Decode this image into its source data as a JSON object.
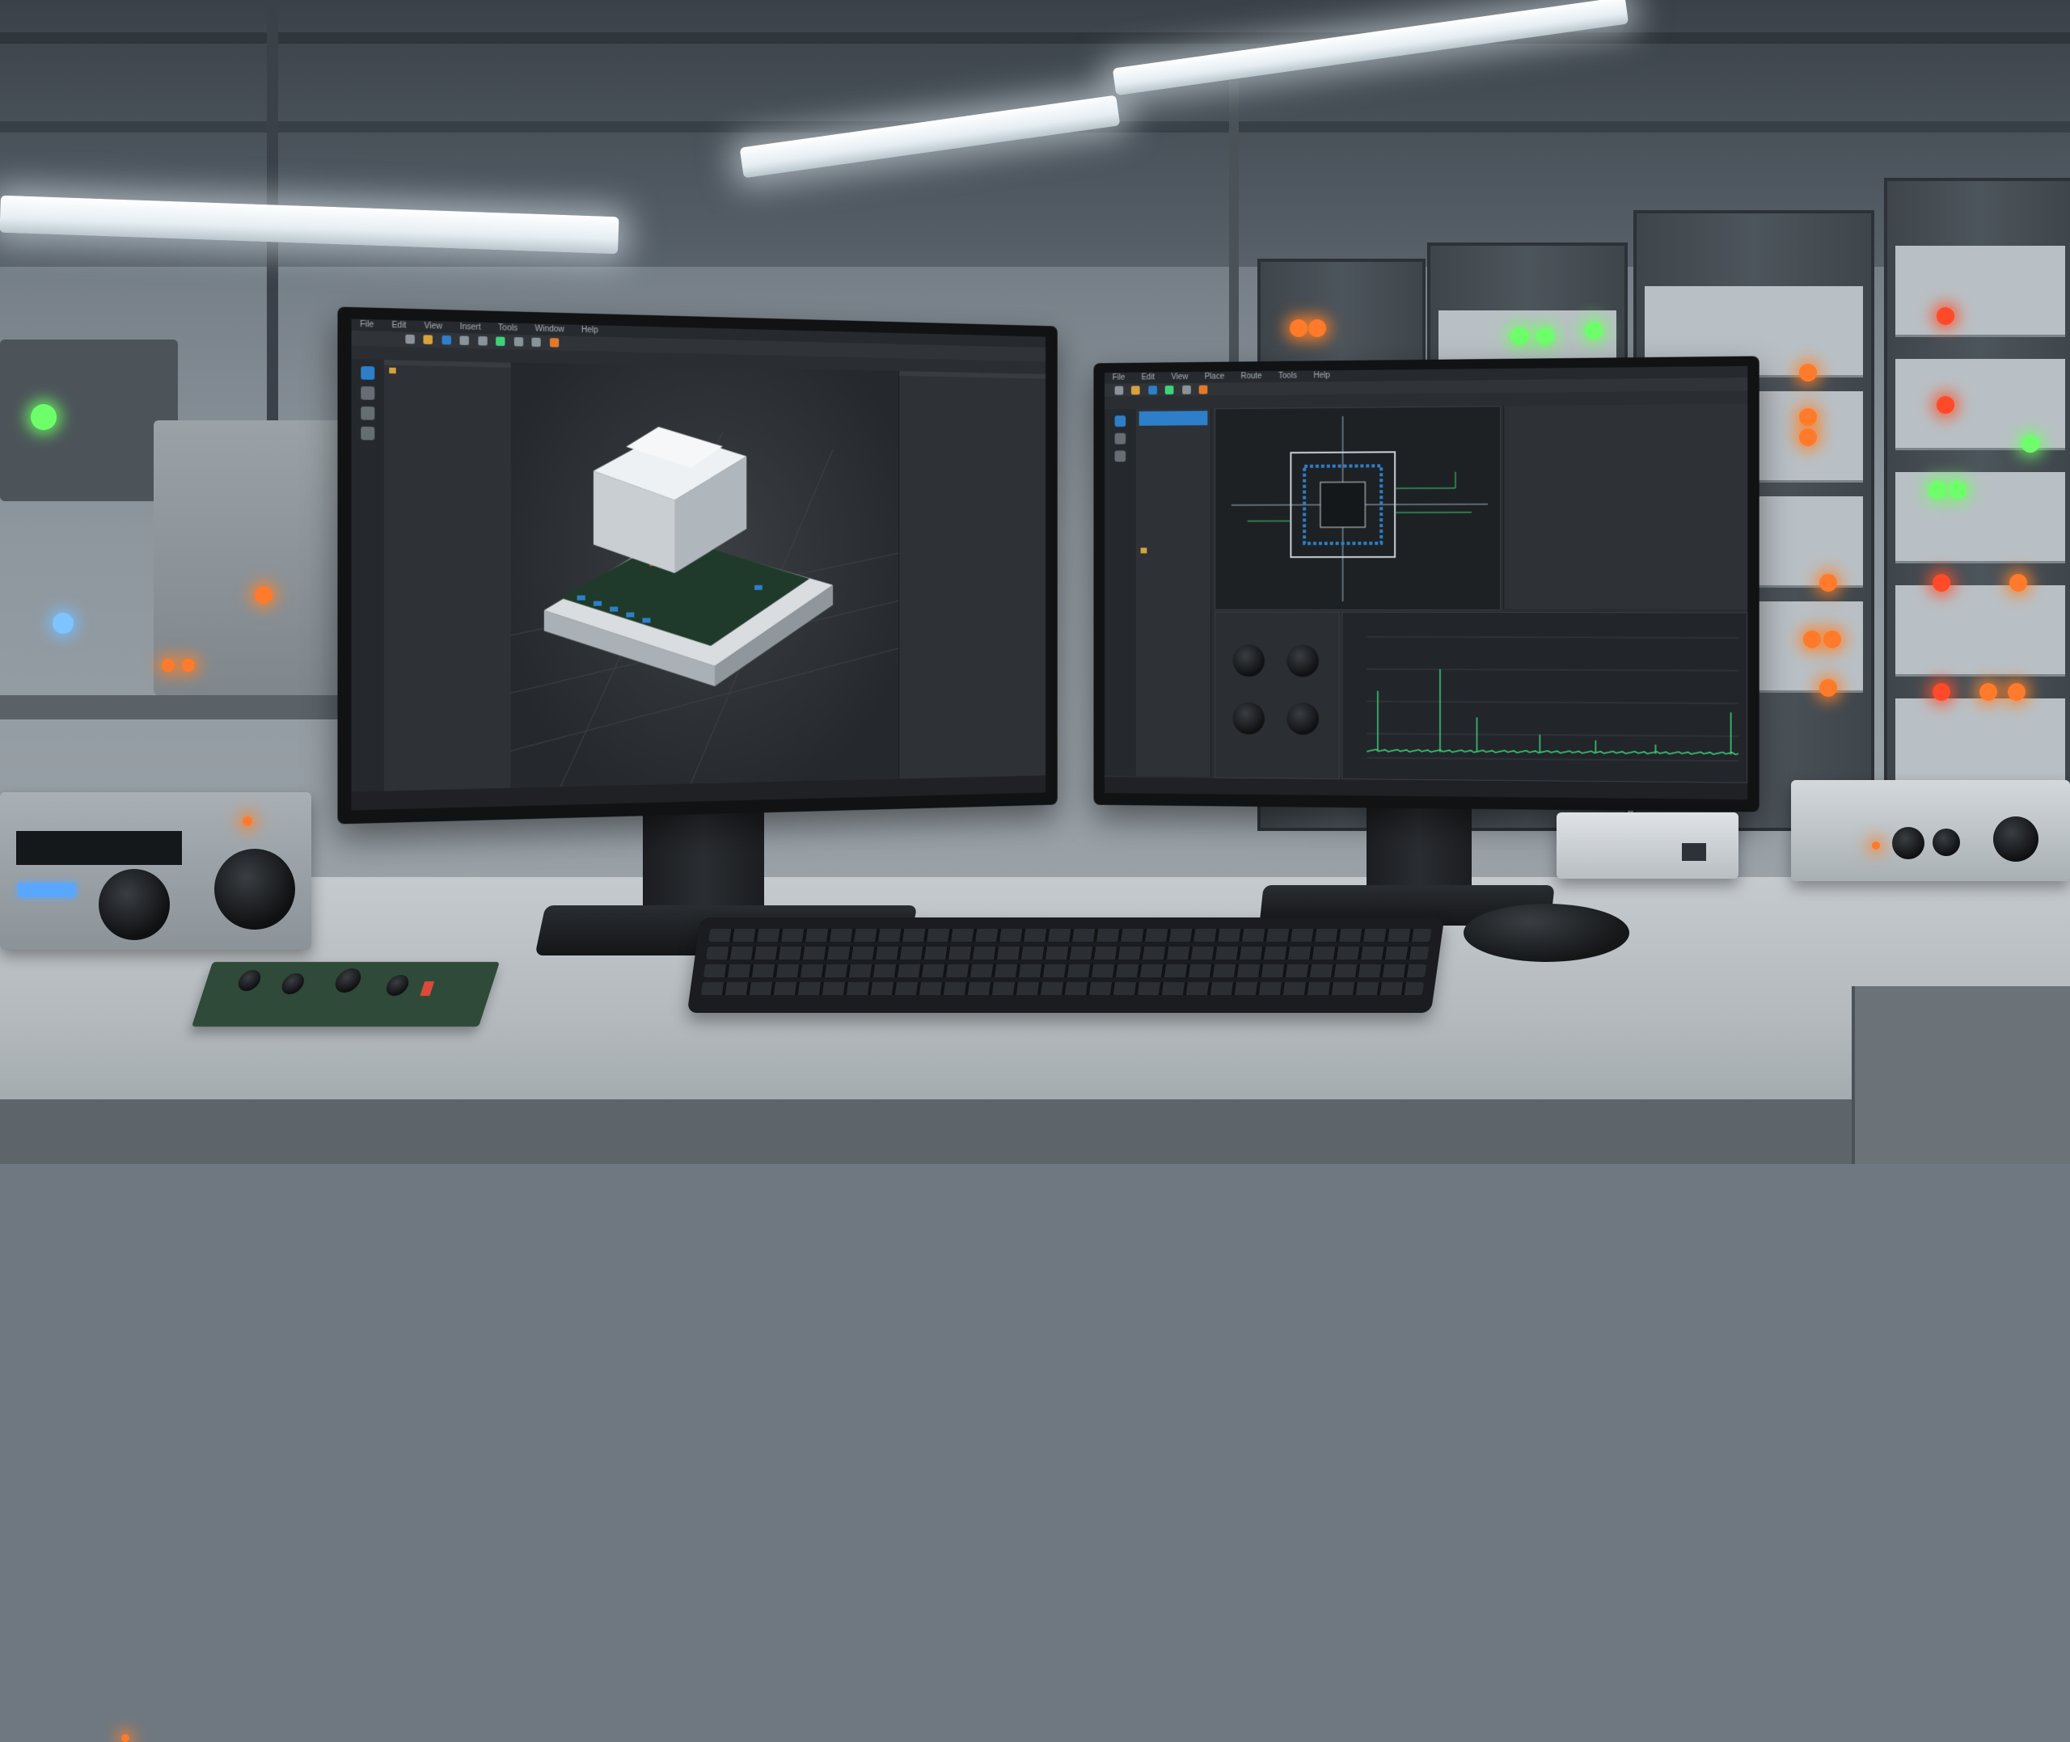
{
  "scene": {
    "description_items": [
      "two monitors",
      "keyboard",
      "mouse",
      "electronics lab"
    ]
  },
  "left_monitor": {
    "window_title": "",
    "menu": [
      "File",
      "Edit",
      "View",
      "Insert",
      "Tools",
      "Window",
      "Help"
    ],
    "tree_title": "",
    "tree_items": [
      "",
      "",
      "",
      "",
      "",
      "",
      "",
      "",
      "",
      "",
      "",
      "",
      "",
      "",
      "",
      "",
      ""
    ],
    "props_title": "",
    "props_rows": [
      "",
      "",
      "",
      "",
      "",
      "",
      "",
      "",
      "",
      "",
      "",
      "",
      "",
      "",
      ""
    ],
    "status": ""
  },
  "right_monitor": {
    "window_title": "",
    "menu": [
      "File",
      "Edit",
      "View",
      "Place",
      "Route",
      "Tools",
      "Help"
    ],
    "tree_items": [
      "",
      "",
      "",
      "",
      "",
      "",
      "",
      "",
      "",
      "",
      "",
      "",
      ""
    ],
    "props_rows": [
      "",
      "",
      "",
      "",
      "",
      "",
      "",
      "",
      "",
      "",
      "",
      ""
    ],
    "status": "",
    "spectrum": {
      "baseline": 0.08,
      "spikes": [
        {
          "pos": 0.03,
          "height": 0.55
        },
        {
          "pos": 0.2,
          "height": 0.72
        },
        {
          "pos": 0.3,
          "height": 0.35
        },
        {
          "pos": 0.47,
          "height": 0.22
        },
        {
          "pos": 0.62,
          "height": 0.18
        },
        {
          "pos": 0.78,
          "height": 0.15
        },
        {
          "pos": 0.98,
          "height": 0.4
        }
      ]
    }
  },
  "colors": {
    "accent_blue": "#2d7fc9",
    "trace_green": "#3ed37a",
    "folder_yellow": "#d7a23a",
    "led_orange": "#ff7a2a"
  }
}
